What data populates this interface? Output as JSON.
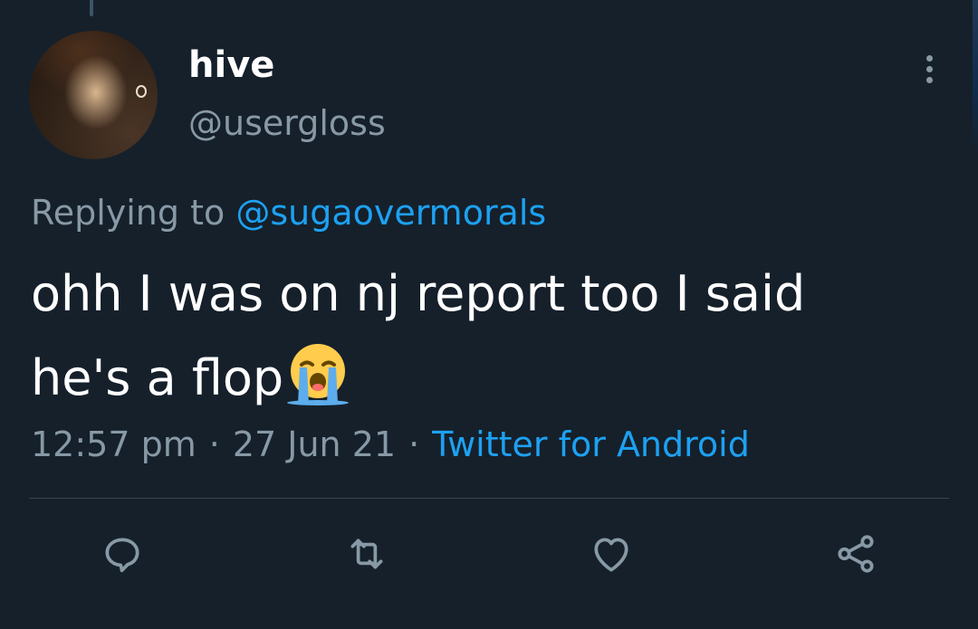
{
  "tweet": {
    "display_name": "hive",
    "handle": "@usergloss",
    "replying_prefix": "Replying to ",
    "replying_to": "@sugaovermorals",
    "text_line1": "ohh I was on nj report too I said",
    "text_line2": "he's a flop",
    "emoji": "loudly-crying-face",
    "time": "12:57 pm",
    "separator": "·",
    "date": "27 Jun 21",
    "source": "Twitter for Android"
  },
  "actions": {
    "reply_icon": "reply-icon",
    "retweet_icon": "retweet-icon",
    "like_icon": "heart-icon",
    "share_icon": "share-icon"
  },
  "colors": {
    "background": "#15202b",
    "primary_text": "#ffffff",
    "secondary_text": "#8899a6",
    "accent": "#1da1f2",
    "divider": "#38444d"
  }
}
